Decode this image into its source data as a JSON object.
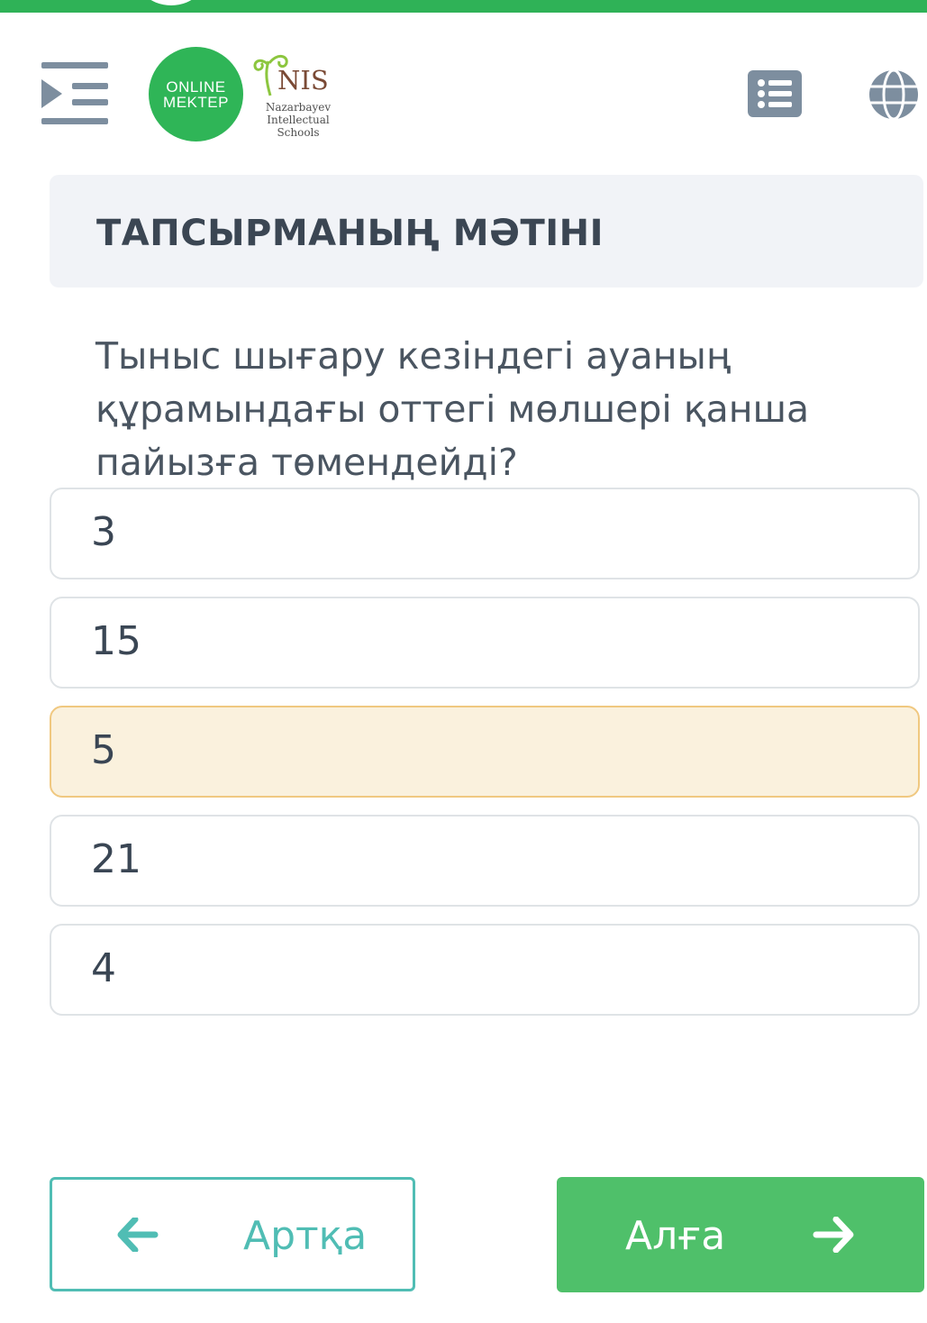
{
  "header": {
    "logo_online_line1": "ONLINE",
    "logo_online_line2": "MEKTEP",
    "logo_nis_abbr": "NIS",
    "logo_nis_line1": "Nazarbayev",
    "logo_nis_line2": "Intellectual",
    "logo_nis_line3": "Schools",
    "icons": [
      "menu-icon",
      "list-icon",
      "globe-icon"
    ]
  },
  "task": {
    "title": "ТАПСЫРМАНЫҢ МӘТІНІ",
    "question_lines": [
      "Тыныс шығару кезіндегі ауаның",
      "құрамындағы оттегі мөлшері қанша",
      "пайызға төмендейді?"
    ]
  },
  "answers": [
    {
      "label": "3",
      "selected": false
    },
    {
      "label": "15",
      "selected": false
    },
    {
      "label": "5",
      "selected": true
    },
    {
      "label": "21",
      "selected": false
    },
    {
      "label": "4",
      "selected": false
    }
  ],
  "navigation": {
    "back_label": "Артқа",
    "next_label": "Алға"
  },
  "colors": {
    "brand_green": "#2fb257",
    "next_button": "#4fc06a",
    "back_accent": "#50bdb4",
    "selected_bg": "#faf1dd",
    "selected_border": "#f0c880"
  }
}
